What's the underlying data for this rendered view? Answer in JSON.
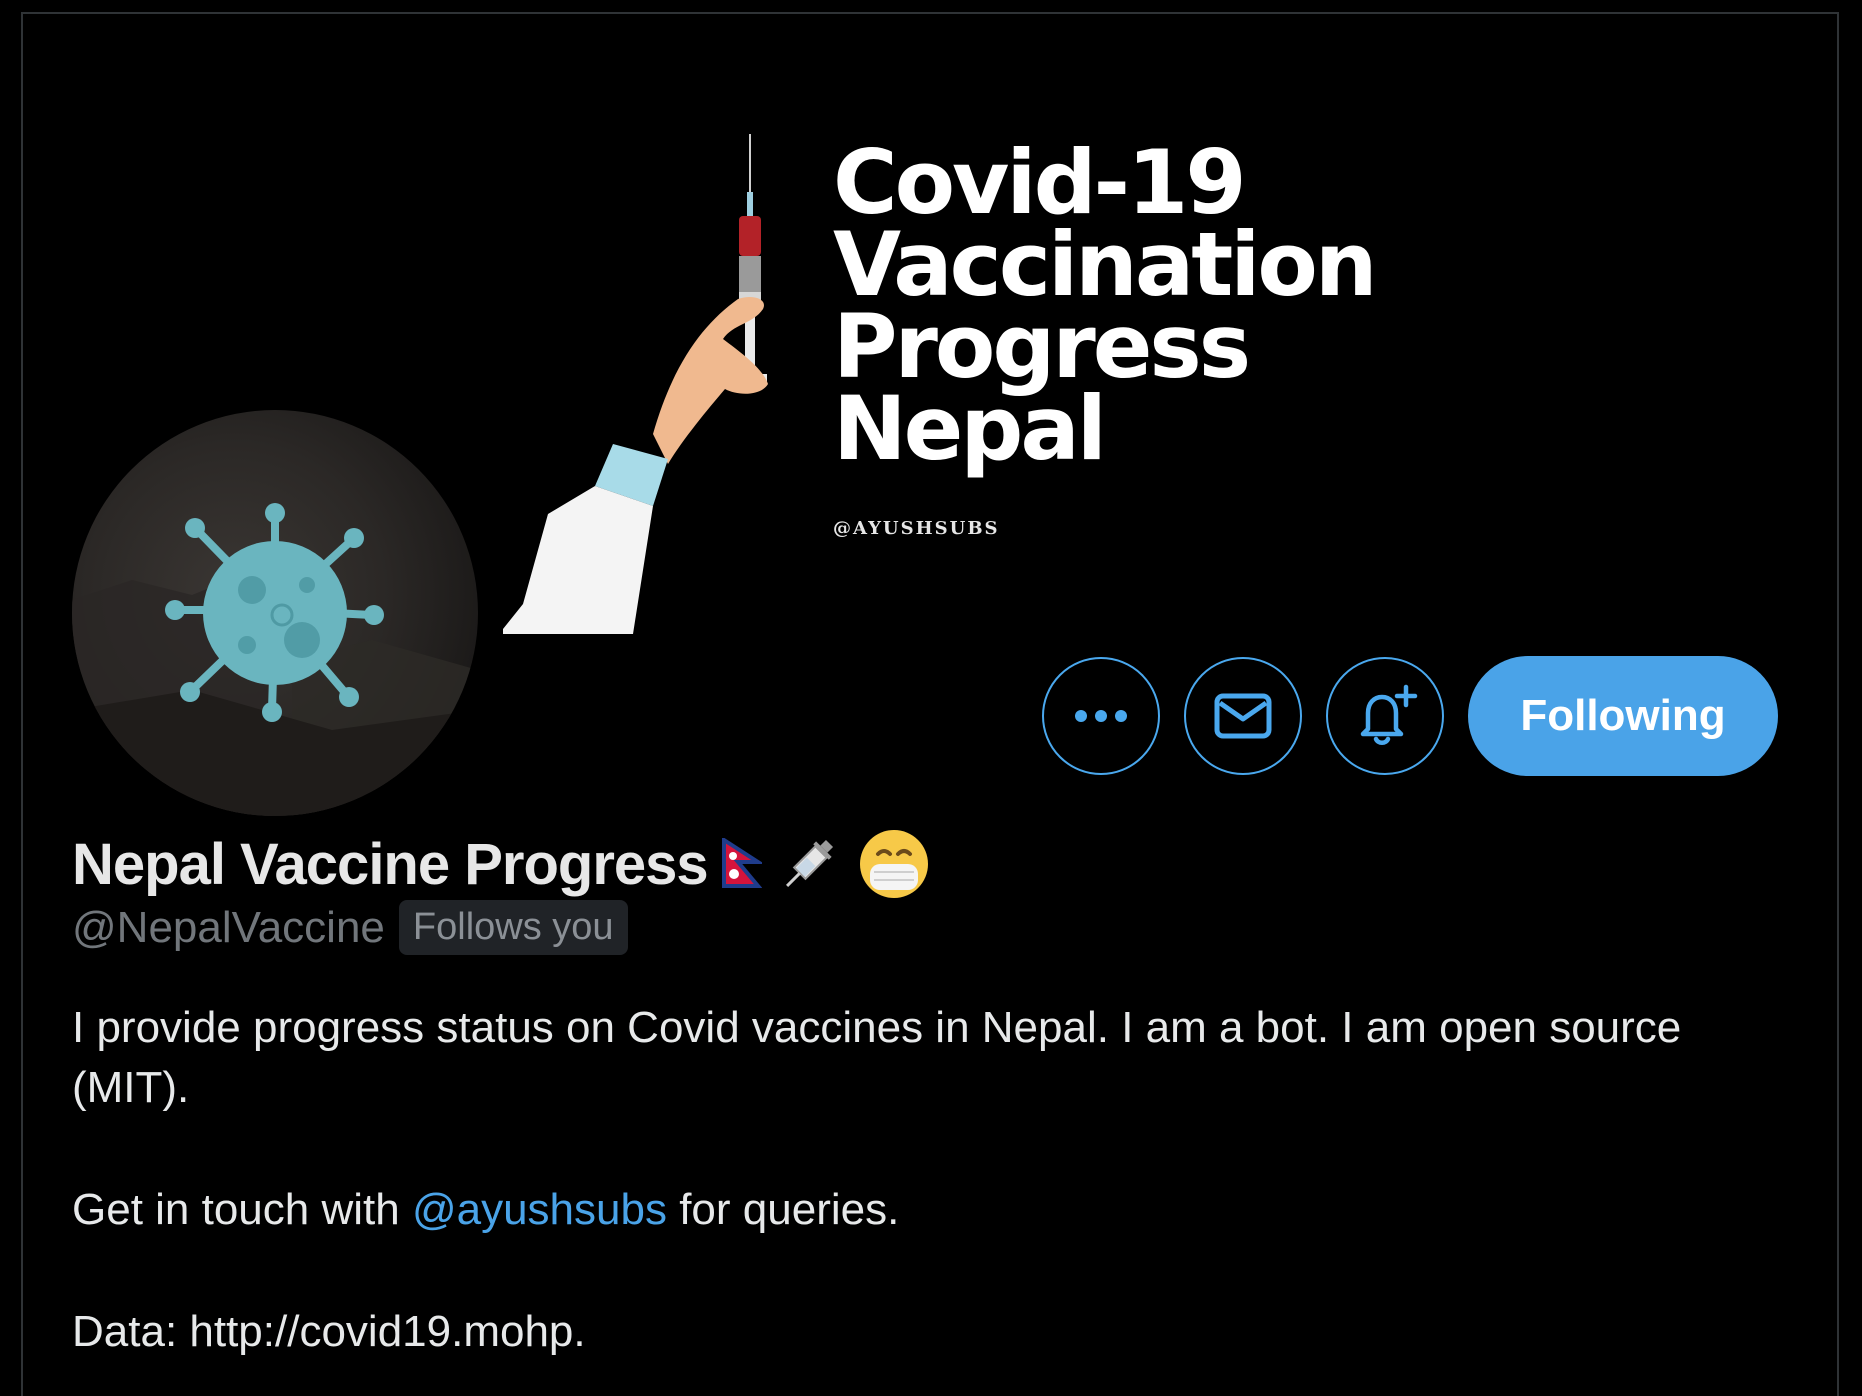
{
  "banner": {
    "title_lines": [
      "Covid-19",
      "Vaccination",
      "Progress",
      "Nepal"
    ],
    "handle": "@AYUSHSUBS"
  },
  "actions": {
    "more_icon": "more-icon",
    "message_icon": "envelope-icon",
    "notify_icon": "bell-plus-icon",
    "follow_label": "Following"
  },
  "profile": {
    "display_name": "Nepal Vaccine Progress",
    "name_emojis": [
      "🇳🇵",
      "💉",
      "😷"
    ],
    "handle": "@NepalVaccine",
    "follows_badge": "Follows you"
  },
  "bio": {
    "line1": "I provide progress status on Covid vaccines in Nepal. I am a bot. I am open source (MIT).",
    "contact_prefix": "Get in touch with ",
    "contact_mention": "@ayushsubs",
    "contact_suffix": " for queries.",
    "data_line": "Data: http://covid19.mohp."
  },
  "colors": {
    "accent": "#4aa3e8",
    "background": "#000000"
  }
}
